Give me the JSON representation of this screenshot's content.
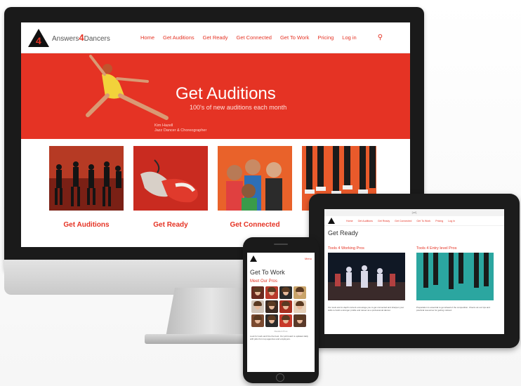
{
  "desktop": {
    "logo": {
      "mark": "4",
      "text_pre": "Answers",
      "text_num": "4",
      "text_post": "Dancers"
    },
    "nav": [
      "Home",
      "Get Auditions",
      "Get Ready",
      "Get Connected",
      "Get To Work",
      "Pricing",
      "Log in"
    ],
    "hero": {
      "title": "Get Auditions",
      "subtitle": "100's of new auditions each month",
      "credit_line1": "Kim Hazell",
      "credit_line2": "Jazz Dancer & Choreographer"
    },
    "tiles": [
      "Get Auditions",
      "Get Ready",
      "Get Connected",
      ""
    ]
  },
  "tablet": {
    "url": "[url]",
    "nav": [
      "Home",
      "Get Auditions",
      "Get Ready",
      "Get Connected",
      "Get To Work",
      "Pricing",
      "Log in"
    ],
    "title": "Get Ready",
    "col1_head": "Tools 4 Working Pros",
    "col2_head": "Tools 4 Entry level Pros",
    "col1_text": "Our tools and in-depth content encourage you to get connected and sharpen your skills to build a stronger profile and career as a professional dancer.",
    "col2_text": "Preparation is essential to get ahead of the competition. Check out our tips and practical resources for getting noticed."
  },
  "phone": {
    "menu": "Menu",
    "title": "Get To Work",
    "subtitle": "Meet Our Pros",
    "caption": "Resident Pros",
    "text": "Look for work and hire the best. Our job board is updated daily with jobs from top agencies and employers."
  },
  "colors": {
    "brand_red": "#e53324",
    "bezel": "#1a1a1a"
  }
}
